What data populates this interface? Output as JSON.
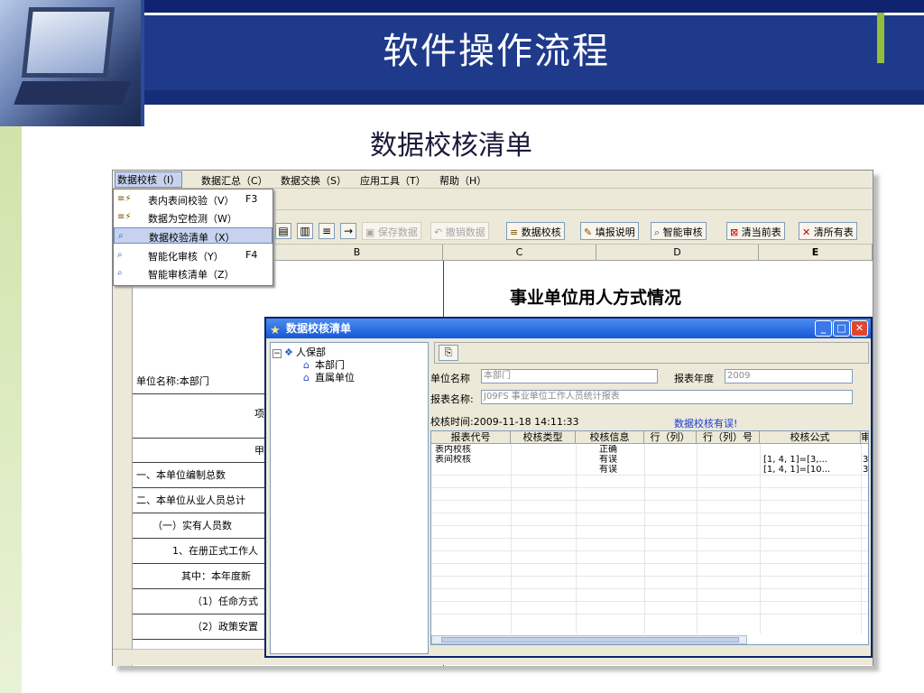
{
  "slide": {
    "title": "软件操作流程",
    "subtitle": "数据校核清单"
  },
  "menubar": [
    "数据校核（I）",
    "数据汇总（C）",
    "数据交换（S）",
    "应用工具（T）",
    "帮助（H）"
  ],
  "dropdown": [
    {
      "label": "表内表间校验（V）",
      "shortcut": "F3",
      "icon": "check-icon"
    },
    {
      "label": "数据为空检测（W）",
      "shortcut": "",
      "icon": "check-icon"
    },
    {
      "label": "数据校验清单（X）",
      "shortcut": "",
      "icon": "list-search-icon",
      "selected": true
    },
    {
      "label": "智能化审核（Y）",
      "shortcut": "F4",
      "icon": "smart-review-icon"
    },
    {
      "label": "智能审核清单（Z）",
      "shortcut": "",
      "icon": "smart-review-list-icon"
    }
  ],
  "toolbar": {
    "save_data": "保存数据",
    "undo_data": "撤销数据",
    "data_check": "数据校核",
    "fill_instructions": "填报说明",
    "smart_review": "智能审核",
    "clear_current": "清当前表",
    "clear_all": "清所有表"
  },
  "sheet": {
    "columns": [
      "B",
      "C",
      "D",
      "E"
    ],
    "report_title": "事业单位用人方式情况",
    "unit_label": "单位名称:本部门",
    "project_label": "项",
    "jia_label": "甲",
    "rows": [
      "一、本单位编制总数",
      "二、本单位从业人员总计",
      "（一）实有人员数",
      "1、在册正式工作人",
      "其中：本年度新",
      "（1）任命方式",
      "（2）政策安置"
    ]
  },
  "dialog": {
    "title": "数据校核清单",
    "tree": {
      "root": "人保部",
      "children": [
        "本部门",
        "直属单位"
      ]
    },
    "unit_name_label": "单位名称",
    "unit_name_value": "本部门",
    "report_year_label": "报表年度",
    "report_year_value": "2009",
    "report_name_label": "报表名称:",
    "report_name_value": "J09FS  事业单位工作人员统计报表",
    "check_time": "校核时间:2009-11-18 14:11:33",
    "error_message": "数据校核有误!",
    "grid_headers": [
      "报表代号",
      "校核类型",
      "校核信息",
      "行（列）",
      "行（列）号",
      "校核公式",
      "审"
    ],
    "grid_rows": [
      {
        "code": "表内校核",
        "type": "",
        "info": "正确",
        "rowcol": "",
        "rowcol_no": "",
        "formula": "",
        "extra": ""
      },
      {
        "code": "表间校核",
        "type": "",
        "info": "有误",
        "rowcol": "",
        "rowcol_no": "",
        "formula": "[1, 4, 1]=[3,...",
        "extra": "3"
      },
      {
        "code": "",
        "type": "",
        "info": "有误",
        "rowcol": "",
        "rowcol_no": "",
        "formula": "[1, 4, 1]=[10...",
        "extra": "3"
      }
    ]
  }
}
